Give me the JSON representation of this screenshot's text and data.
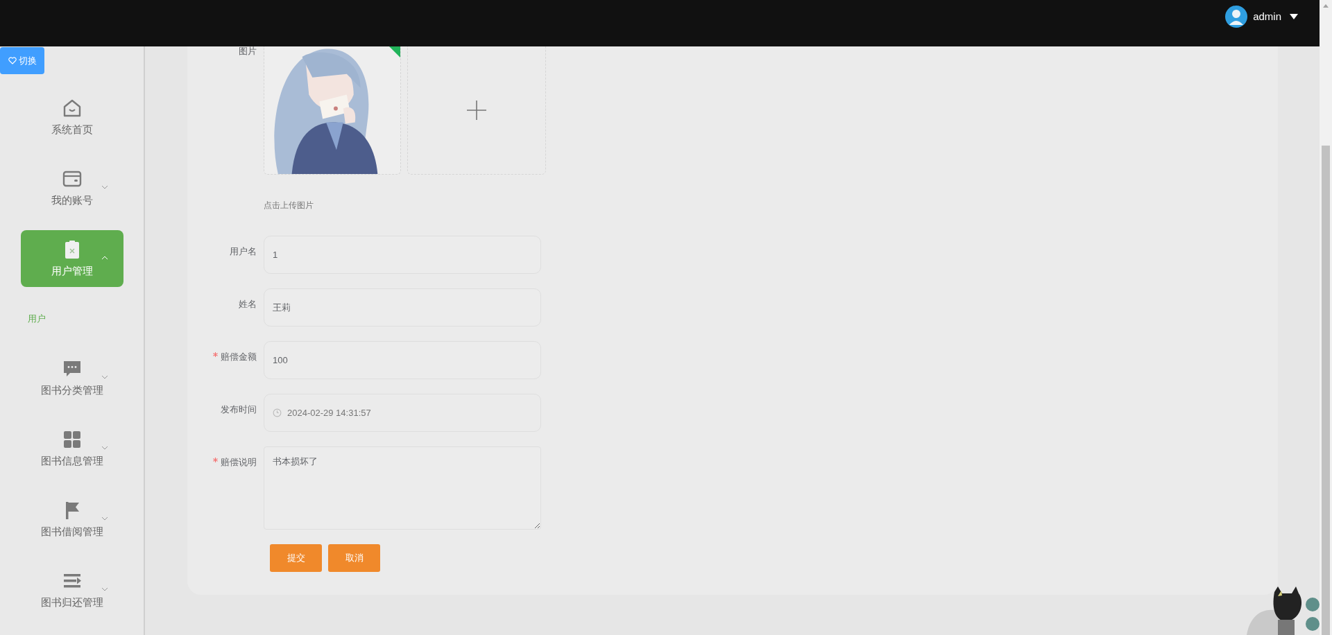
{
  "header": {
    "user_name": "admin"
  },
  "switch_button": {
    "label": "切换"
  },
  "sidebar": {
    "items": [
      {
        "label": "系统首页",
        "selected": false
      },
      {
        "label": "我的账号",
        "selected": false,
        "expanded": false
      },
      {
        "label": "用户管理",
        "selected": true,
        "expanded": true,
        "children": [
          {
            "label": "用户",
            "selected": true
          }
        ]
      },
      {
        "label": "图书分类管理",
        "selected": false,
        "expanded": false
      },
      {
        "label": "图书信息管理",
        "selected": false,
        "expanded": false
      },
      {
        "label": "图书借阅管理",
        "selected": false,
        "expanded": false
      },
      {
        "label": "图书归还管理",
        "selected": false,
        "expanded": false
      }
    ]
  },
  "form": {
    "fields": [
      {
        "label": "图片",
        "required": false,
        "hint": "点击上传图片",
        "uploaded": true
      },
      {
        "kind": "text",
        "label": "用户名",
        "required": false,
        "value": "1"
      },
      {
        "kind": "text",
        "label": "姓名",
        "required": false,
        "value": "王莉"
      },
      {
        "kind": "text",
        "label": "赔偿金额",
        "required": true,
        "value": "100"
      },
      {
        "kind": "date",
        "label": "发布时间",
        "required": false,
        "value": "2024-02-29 14:31:57"
      },
      {
        "kind": "textarea",
        "label": "赔偿说明",
        "required": true,
        "value": "书本损坏了"
      }
    ],
    "buttons": [
      "提交",
      "取消"
    ]
  }
}
